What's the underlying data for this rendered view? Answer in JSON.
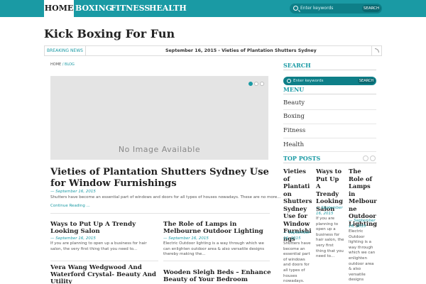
{
  "nav": {
    "items": [
      "HOME",
      "BOXING",
      "FITNESS",
      "HEALTH"
    ],
    "search_placeholder": "Enter keywords",
    "search_button": "SEARCH"
  },
  "site": {
    "title": "Kick Boxing For Fun"
  },
  "breaking": {
    "label": "BREAKING NEWS",
    "text": "September 16, 2015 - Vieties of Plantation Shutters Sydney",
    "rss_icon": "rss-icon"
  },
  "breadcrumb": {
    "home": "HOME",
    "sep": "/",
    "current": "BLOG"
  },
  "slider": {
    "placeholder": "No Image Available"
  },
  "featured": {
    "title": "Vieties of Plantation Shutters Sydney Use for Window Furnishings",
    "date": "— September 16, 2015",
    "excerpt": "Shutters have become an essential part of windows and doors for all types of houses nowadays. These are no more...",
    "more": "Continue Reading ..."
  },
  "posts": [
    {
      "title": "Ways to Put Up A Trendy Looking Salon",
      "date": "— September 16, 2015",
      "excerpt": "If you are planning to open up a business for hair salon, the very first thing that you need to..."
    },
    {
      "title": "The Role of Lamps in Melbourne Outdoor Lighting",
      "date": "— September 16, 2015",
      "excerpt": "Electric Outdoor lighting is a way through which we can enlighten outdoor area & also versatile designs thereby making the..."
    },
    {
      "title": "Vera Wang Wedgwood And Waterford Crystal- Beauty And Utility"
    },
    {
      "title": "Wooden Sleigh Beds – Enhance Beauty of Your Bedroom"
    }
  ],
  "sidebar": {
    "search_heading": "SEARCH",
    "search_placeholder": "Enter keywords",
    "search_button": "SEARCH",
    "menu_heading": "MENU",
    "menu": [
      "Beauty",
      "Boxing",
      "Fitness",
      "Health"
    ],
    "top_posts_heading": "TOP POSTS",
    "top_posts": [
      {
        "title": "Vieties of Plantati on Shutters Sydney Use for Window Furnishi ngs",
        "date": "— September 16, 2015",
        "excerpt": "Shutters have become an essential part of windows and doors for all types of houses nowadays."
      },
      {
        "title": "Ways to Put Up A Trendy Looking Salon",
        "date": "— September 16, 2015",
        "excerpt": "If you are planning to open up a business for hair salon, the very first thing that you need to..."
      },
      {
        "title": "The Role of Lamps in Melbour ne Outdoor Lighting",
        "date": "— September 16, 2015",
        "excerpt": "Electric Outdoor lighting is a way through which we can enlighten outdoor area & also versatile designs"
      }
    ]
  },
  "colors": {
    "accent": "#1a9aa4",
    "accent_dark": "#0e7f88"
  }
}
